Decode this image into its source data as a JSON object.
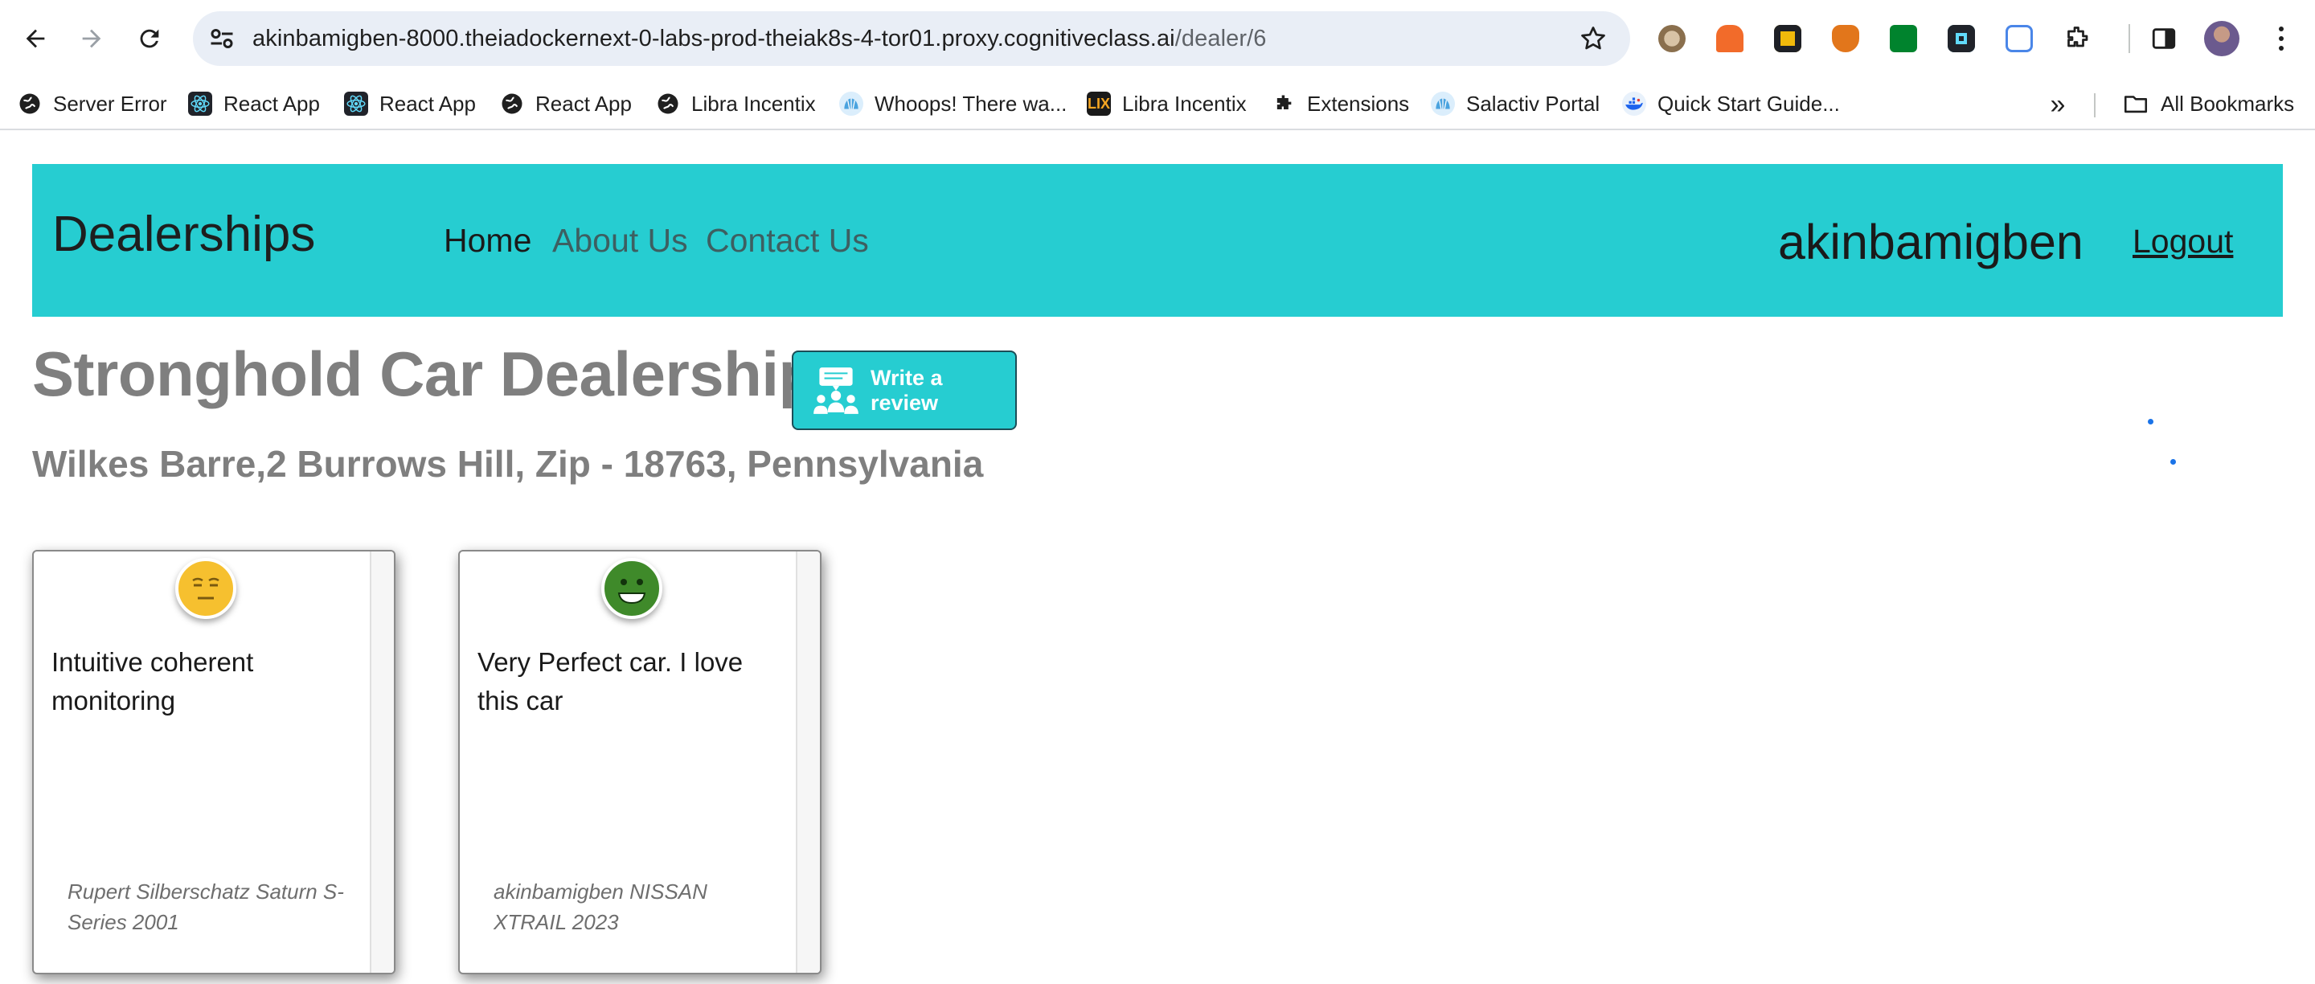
{
  "browser": {
    "url_host": "akinbamigben-8000.theiadockernext-0-labs-prod-theiak8s-4-tor01.proxy.cognitiveclass.ai",
    "url_path": "/dealer/6",
    "bookmarks": [
      {
        "label": "Server Error",
        "icon": "globe-icon"
      },
      {
        "label": "React App",
        "icon": "react-icon"
      },
      {
        "label": "React App",
        "icon": "react-icon"
      },
      {
        "label": "React App",
        "icon": "globe-icon"
      },
      {
        "label": "Libra Incentix",
        "icon": "globe-icon"
      },
      {
        "label": "Whoops! There wa...",
        "icon": "shell-icon"
      },
      {
        "label": "Libra Incentix",
        "icon": "lix-icon"
      },
      {
        "label": "Extensions",
        "icon": "puzzle-icon"
      },
      {
        "label": "Salactiv Portal",
        "icon": "shell-icon"
      },
      {
        "label": "Quick Start Guide...",
        "icon": "docker-icon"
      }
    ],
    "all_bookmarks": "All Bookmarks"
  },
  "navbar": {
    "brand": "Dealerships",
    "links": [
      "Home",
      "About Us",
      "Contact Us"
    ],
    "username": "akinbamigben",
    "logout": "Logout",
    "color": "#26cdd1"
  },
  "dealer": {
    "name": "Stronghold Car Dealership",
    "write_review": "Write a review",
    "address": "Wilkes Barre,2 Burrows Hill, Zip - 18763, Pennsylvania"
  },
  "reviews": [
    {
      "sentiment": "neutral",
      "text": "Intuitive coherent monitoring",
      "meta": "Rupert Silberschatz Saturn S-Series 2001"
    },
    {
      "sentiment": "positive",
      "text": "Very Perfect car. I love this car",
      "meta": "akinbamigben NISSAN XTRAIL 2023"
    }
  ]
}
